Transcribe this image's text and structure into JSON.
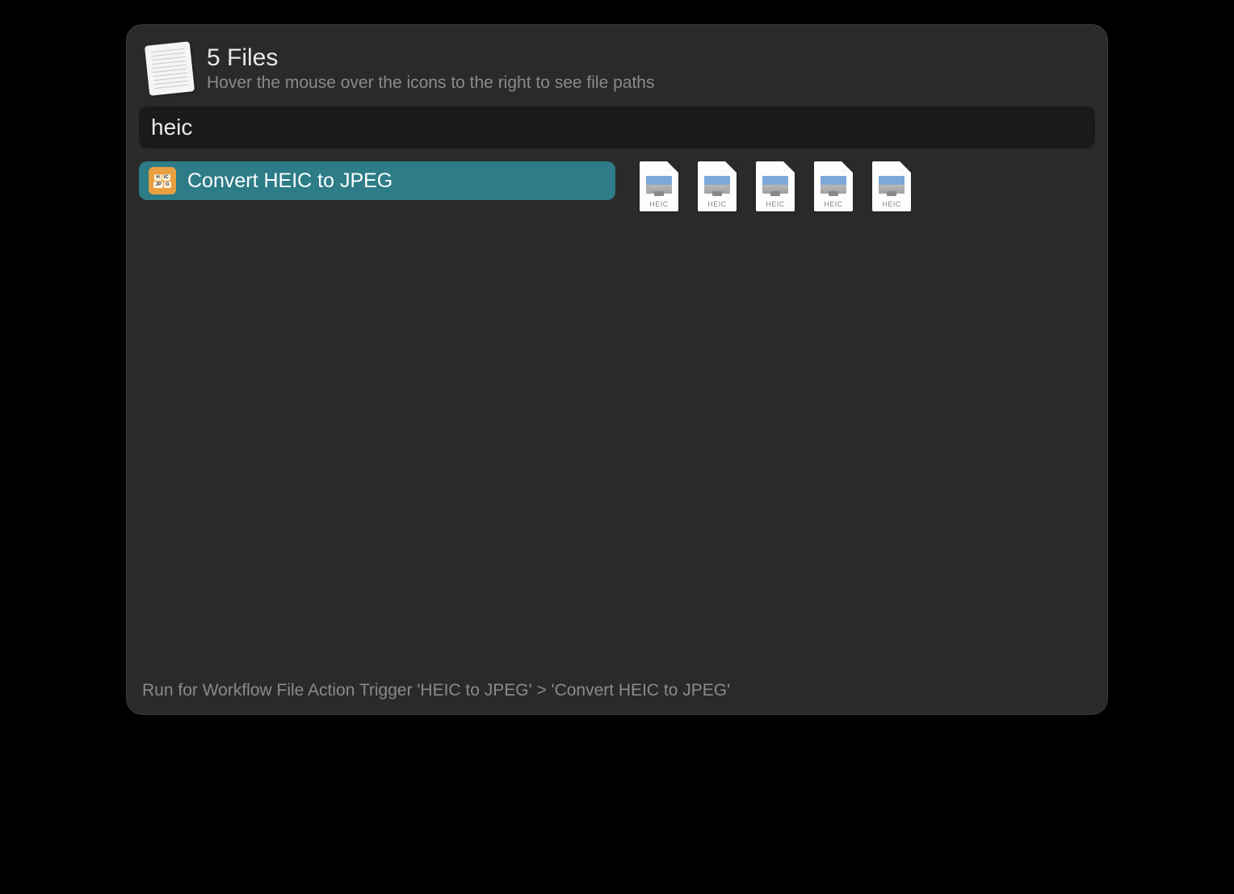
{
  "header": {
    "title": "5 Files",
    "subtitle": "Hover the mouse over the icons to the right to see file paths"
  },
  "search": {
    "value": "heic"
  },
  "action": {
    "label": "Convert HEIC to JPEG",
    "icon_top_left": "H",
    "icon_top_right": "IC",
    "icon_bottom_left": "JP",
    "icon_bottom_right": "G"
  },
  "files": [
    {
      "type_label": "HEIC"
    },
    {
      "type_label": "HEIC"
    },
    {
      "type_label": "HEIC"
    },
    {
      "type_label": "HEIC"
    },
    {
      "type_label": "HEIC"
    }
  ],
  "footer": {
    "text": "Run for Workflow File Action Trigger 'HEIC to JPEG' > 'Convert HEIC to JPEG'"
  }
}
